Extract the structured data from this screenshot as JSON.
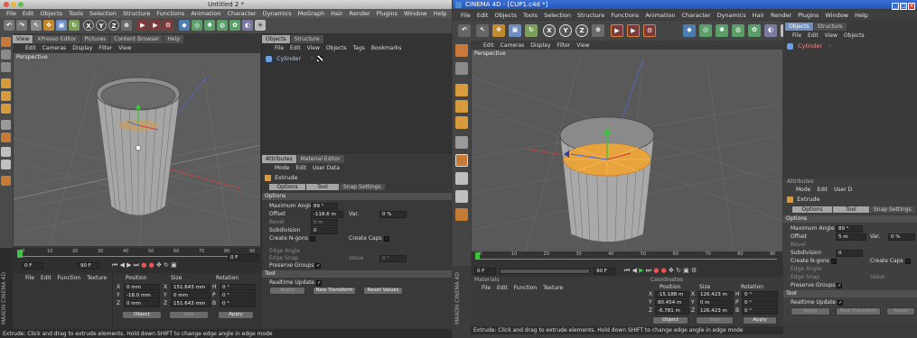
{
  "left": {
    "title": "Untitled 2 *",
    "menu": [
      "File",
      "Edit",
      "Objects",
      "Tools",
      "Selection",
      "Structure",
      "Functions",
      "Animation",
      "Character",
      "Dynamics",
      "MoGraph",
      "Hair",
      "Render",
      "Plugins",
      "Window",
      "Help"
    ],
    "viewport_tabs": [
      "View",
      "XPresso Editor",
      "Pictures",
      "Content Browser",
      "Help"
    ],
    "viewport_menu": [
      "Edit",
      "Cameras",
      "Display",
      "Filter",
      "View"
    ],
    "viewport_label": "Perspective",
    "obj_tabs": [
      "Objects",
      "Structure"
    ],
    "obj_menu": [
      "File",
      "Edit",
      "View",
      "Objects",
      "Tags",
      "Bookmarks"
    ],
    "object_name": "Cylinder",
    "attr_tabs": [
      "Attributes",
      "Material Editor"
    ],
    "attr_menu": [
      "Mode",
      "Edit",
      "User Data"
    ],
    "tool_name": "Extrude",
    "sub_tabs": [
      "Options",
      "Tool",
      "Snap Settings"
    ],
    "options_header": "Options",
    "max_angle_label": "Maximum Angle",
    "max_angle": "89 °",
    "offset_label": "Offset",
    "offset": "-118.6 m",
    "var_label": "Var.",
    "var_value": "0 %",
    "bevel_label": "Bevel",
    "bevel": "0 m",
    "subdivision_label": "Subdivision",
    "subdivision": "0",
    "create_ngons": "Create N-gons",
    "create_caps": "Create Caps",
    "edge_angle": "Edge Angle",
    "edge_snap": "Edge Snap",
    "value_label": "Value",
    "value": "0 °",
    "preserve_groups": "Preserve Groups",
    "tool_header": "Tool",
    "realtime": "Realtime Update",
    "apply": "Apply",
    "new_transform": "New Transform",
    "reset_values": "Reset Values",
    "timeline_ticks": [
      "0",
      "10",
      "20",
      "30",
      "40",
      "50",
      "60",
      "70",
      "80",
      "90"
    ],
    "frame_start": "0 F",
    "frame_end": "90 F",
    "frame_cur": "0 F",
    "mat_menu": [
      "File",
      "Edit",
      "Function",
      "Texture"
    ],
    "coord_headers": [
      "Position",
      "Size",
      "Rotation"
    ],
    "coords": [
      {
        "axis": "X",
        "pos": "0 mm",
        "size_axis": "X",
        "size": "151.643 mm",
        "rot_axis": "H",
        "rot": "0 °"
      },
      {
        "axis": "Y",
        "pos": "-18.0 mm",
        "size_axis": "Y",
        "size": "0 mm",
        "rot_axis": "P",
        "rot": "0 °"
      },
      {
        "axis": "Z",
        "pos": "0 mm",
        "size_axis": "Z",
        "size": "151.643 mm",
        "rot_axis": "B",
        "rot": "0 °"
      }
    ],
    "coord_mode": "Object",
    "coord_size": "Size",
    "coord_apply": "Apply",
    "logo": "MAXON CINEMA 4D",
    "status": "Extrude: Click and drag to extrude elements. Hold down SHIFT to change edge angle in edge mode"
  },
  "right": {
    "title": "CINEMA 4D - [CUP1.c4d *]",
    "menu": [
      "File",
      "Edit",
      "Objects",
      "Tools",
      "Selection",
      "Structure",
      "Functions",
      "Animation",
      "Character",
      "Dynamics",
      "Hair",
      "Render",
      "Plugins",
      "Window",
      "Help"
    ],
    "viewport_menu": [
      "Edit",
      "Cameras",
      "Display",
      "Filter",
      "View"
    ],
    "viewport_label": "Perspective",
    "obj_tabs": [
      "Objects",
      "Structure"
    ],
    "obj_menu": [
      "File",
      "Edit",
      "View",
      "Objects"
    ],
    "object_name": "Cylinder",
    "attr_tab": "Attributes",
    "attr_menu": [
      "Mode",
      "Edit",
      "User D"
    ],
    "tool_name": "Extrude",
    "sub_tabs": [
      "Options",
      "Tool",
      "Snap Settings"
    ],
    "options_header": "Options",
    "max_angle_label": "Maximum Angle",
    "max_angle": "89 °",
    "offset_label": "Offset",
    "offset": "5 m",
    "var_label": "Var.",
    "var_value": "0 %",
    "bevel_label": "Bevel",
    "subdivision_label": "Subdivision",
    "subdivision": "0",
    "create_ngons": "Create N-gons",
    "create_caps": "Create Caps",
    "edge_angle": "Edge Angle",
    "edge_snap": "Edge Snap",
    "value_label": "Value",
    "preserve_groups": "Preserve Groups",
    "tool_header": "Tool",
    "realtime": "Realtime Update",
    "apply": "Apply",
    "new_transform": "New Transform",
    "reset": "Reset",
    "timeline_ticks": [
      "0",
      "10",
      "20",
      "30",
      "40",
      "50",
      "60",
      "70",
      "80",
      "90"
    ],
    "frame_start": "0 F",
    "frame_end": "90 F",
    "mat_header": "Materials",
    "mat_menu": [
      "File",
      "Edit",
      "Function",
      "Texture"
    ],
    "coord_header": "Coordinates",
    "coord_headers": [
      "Position",
      "Size",
      "Rotation"
    ],
    "coords": [
      {
        "axis": "X",
        "pos": "-15.188 m",
        "size_axis": "X",
        "size": "126.423 m",
        "rot_axis": "H",
        "rot": "0 °"
      },
      {
        "axis": "Y",
        "pos": "80.454 m",
        "size_axis": "Y",
        "size": "0 m",
        "rot_axis": "P",
        "rot": "0 °"
      },
      {
        "axis": "Z",
        "pos": "-6.781 m",
        "size_axis": "Z",
        "size": "126.423 m",
        "rot_axis": "B",
        "rot": "0 °"
      }
    ],
    "coord_mode": "Object",
    "coord_size": "Size",
    "coord_apply": "Apply",
    "logo": "MAXON CINEMA 4D",
    "status": "Extrude: Click and drag to extrude elements. Hold down SHIFT to change edge angle in edge mode"
  }
}
